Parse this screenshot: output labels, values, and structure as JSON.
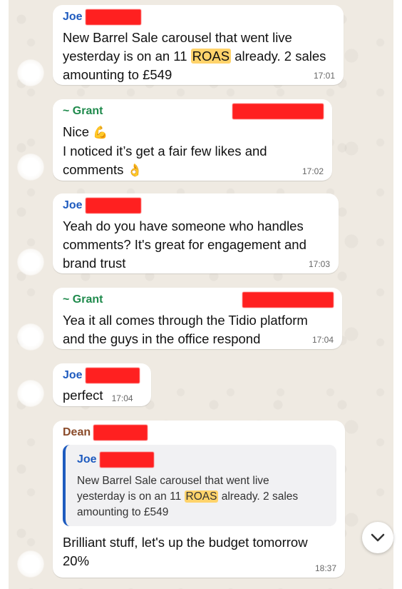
{
  "messages": [
    {
      "sender": "Joe",
      "lines": [
        "New Barrel Sale carousel that went live",
        "yesterday is on an 11 ",
        "ROAS",
        " already. 2 sales",
        "amounting to £549"
      ],
      "time": "17:01"
    },
    {
      "sender": "~ Grant",
      "line1": "Nice",
      "line2": "I noticed it’s get a fair few likes and",
      "line3": "comments",
      "emoji1": "💪",
      "emoji2": "👌",
      "time": "17:02"
    },
    {
      "sender": "Joe",
      "lines": [
        "Yeah do you have someone who handles",
        "comments? It's great for engagement and",
        "brand trust"
      ],
      "time": "17:03"
    },
    {
      "sender": "~ Grant",
      "lines": [
        "Yea it all comes through the Tidio platform",
        "and the guys in the office respond"
      ],
      "time": "17:04"
    },
    {
      "sender": "Joe",
      "text": "perfect",
      "time": "17:04"
    },
    {
      "sender": "Dean",
      "quote": {
        "sender": "Joe",
        "line1": "New Barrel Sale carousel that went live",
        "line2a": "yesterday is on an 11 ",
        "line2hl": "ROAS",
        "line2b": " already. 2 sales",
        "line3": "amounting to £549"
      },
      "lines": [
        "Brilliant stuff, let's up the budget tomorrow",
        "20%"
      ],
      "time": "18:37"
    }
  ],
  "icons": {
    "scroll_down": "chevron-down-icon"
  }
}
